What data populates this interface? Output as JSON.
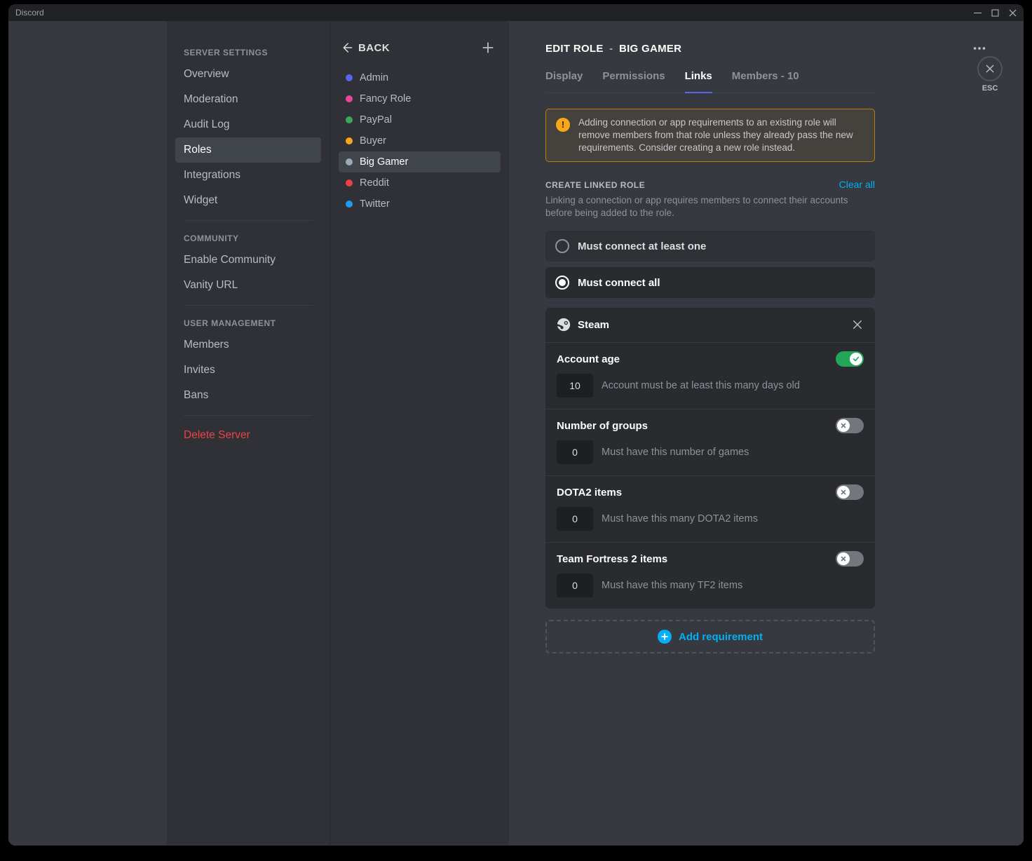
{
  "window": {
    "title": "Discord",
    "esc_label": "ESC"
  },
  "sidebar": {
    "sections": [
      {
        "heading": "SERVER SETTINGS",
        "items": [
          {
            "key": "overview",
            "label": "Overview"
          },
          {
            "key": "moderation",
            "label": "Moderation"
          },
          {
            "key": "audit-log",
            "label": "Audit Log"
          },
          {
            "key": "roles",
            "label": "Roles",
            "selected": true
          },
          {
            "key": "integrations",
            "label": "Integrations"
          },
          {
            "key": "widget",
            "label": "Widget"
          }
        ]
      },
      {
        "heading": "COMMUNITY",
        "items": [
          {
            "key": "enable-community",
            "label": "Enable Community"
          },
          {
            "key": "vanity-url",
            "label": "Vanity URL"
          }
        ]
      },
      {
        "heading": "USER MANAGEMENT",
        "items": [
          {
            "key": "members",
            "label": "Members"
          },
          {
            "key": "invites",
            "label": "Invites"
          },
          {
            "key": "bans",
            "label": "Bans"
          }
        ]
      }
    ],
    "danger_item": {
      "key": "delete-server",
      "label": "Delete Server"
    }
  },
  "rolecol": {
    "back_label": "BACK",
    "roles": [
      {
        "name": "Admin",
        "color": "#5865f2"
      },
      {
        "name": "Fancy Role",
        "color": "#eb459e"
      },
      {
        "name": "PayPal",
        "color": "#3ba55c"
      },
      {
        "name": "Buyer",
        "color": "#faa61a"
      },
      {
        "name": "Big Gamer",
        "color": "#99aab5",
        "selected": true
      },
      {
        "name": "Reddit",
        "color": "#ed4245"
      },
      {
        "name": "Twitter",
        "color": "#1d9bf0"
      }
    ]
  },
  "main": {
    "title_prefix": "EDIT ROLE",
    "title_role": "BIG GAMER",
    "tabs": [
      {
        "key": "display",
        "label": "Display"
      },
      {
        "key": "permissions",
        "label": "Permissions"
      },
      {
        "key": "links",
        "label": "Links",
        "active": true
      },
      {
        "key": "members",
        "label": "Members - 10"
      }
    ],
    "notice": "Adding connection or app requirements to an existing role will remove members from that role unless they already pass the new requirements. Consider creating a new role instead.",
    "section": {
      "heading": "CREATE LINKED ROLE",
      "clear_all": "Clear all",
      "sub": "Linking a connection or app requires members to connect their accounts before being added to the role."
    },
    "radios": {
      "at_least_one": "Must connect at least one",
      "all": "Must connect all"
    },
    "steam": {
      "title": "Steam",
      "rows": {
        "account_age": {
          "label": "Account age",
          "value": "10",
          "desc": "Account must be at least this many days old",
          "enabled": true
        },
        "groups": {
          "label": "Number of groups",
          "value": "0",
          "desc": "Must have this number of games",
          "enabled": false
        },
        "dota2": {
          "label": "DOTA2 items",
          "value": "0",
          "desc": "Must have this many DOTA2 items",
          "enabled": false
        },
        "tf2": {
          "label": "Team Fortress 2 items",
          "value": "0",
          "desc": "Must have this many TF2 items",
          "enabled": false
        }
      }
    },
    "add_requirement_label": "Add requirement"
  }
}
